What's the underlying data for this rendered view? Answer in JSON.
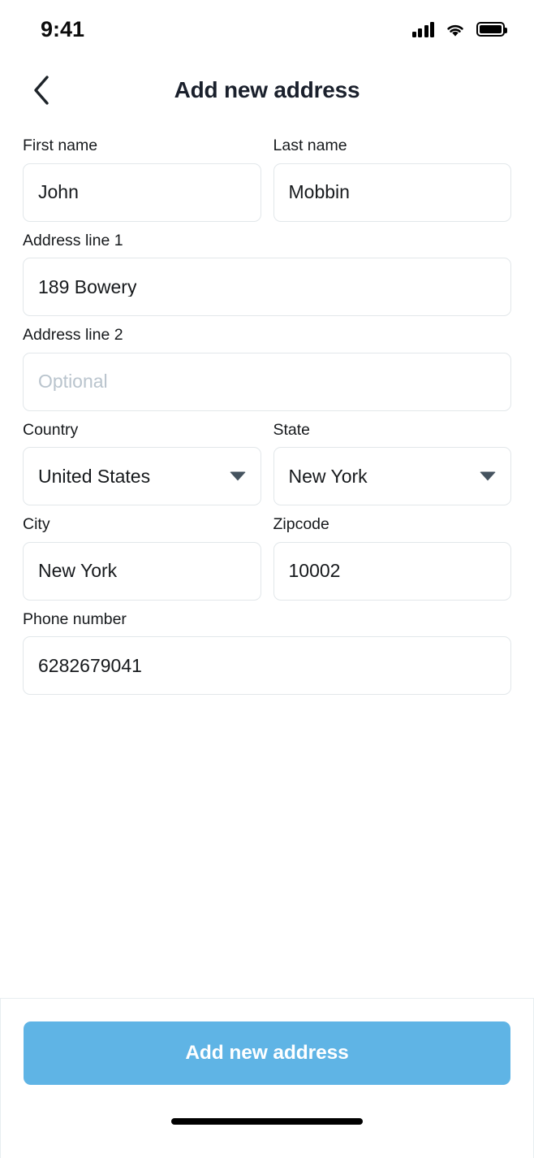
{
  "status_bar": {
    "time": "9:41",
    "icons": [
      "cellular-signal-icon",
      "wifi-icon",
      "battery-icon"
    ]
  },
  "header": {
    "back_icon": "chevron-left-icon",
    "title": "Add new address"
  },
  "form": {
    "rows": [
      {
        "fields": [
          {
            "label": "First name",
            "value": "John",
            "placeholder": "",
            "type": "text"
          },
          {
            "label": "Last name",
            "value": "Mobbin",
            "placeholder": "",
            "type": "text"
          }
        ]
      },
      {
        "fields": [
          {
            "label": "Address line 1",
            "value": "189 Bowery",
            "placeholder": "",
            "type": "text"
          }
        ]
      },
      {
        "fields": [
          {
            "label": "Address line 2",
            "value": "",
            "placeholder": "Optional",
            "type": "text"
          }
        ]
      },
      {
        "fields": [
          {
            "label": "Country",
            "value": "United States",
            "placeholder": "",
            "type": "select"
          },
          {
            "label": "State",
            "value": "New York",
            "placeholder": "",
            "type": "select"
          }
        ]
      },
      {
        "fields": [
          {
            "label": "City",
            "value": "New York",
            "placeholder": "",
            "type": "text"
          },
          {
            "label": "Zipcode",
            "value": "10002",
            "placeholder": "",
            "type": "text"
          }
        ]
      },
      {
        "fields": [
          {
            "label": "Phone number",
            "value": "6282679041",
            "placeholder": "",
            "type": "text"
          }
        ]
      }
    ]
  },
  "footer": {
    "cta_label": "Add new address",
    "cta_color": "#5FB4E5",
    "home_indicator": true
  },
  "colors": {
    "accent": "#5FB4E5",
    "text": "#16191C",
    "title": "#1A202C",
    "placeholder": "#B9C4CD",
    "border": "#E2E7EA",
    "caret": "#45535F"
  }
}
